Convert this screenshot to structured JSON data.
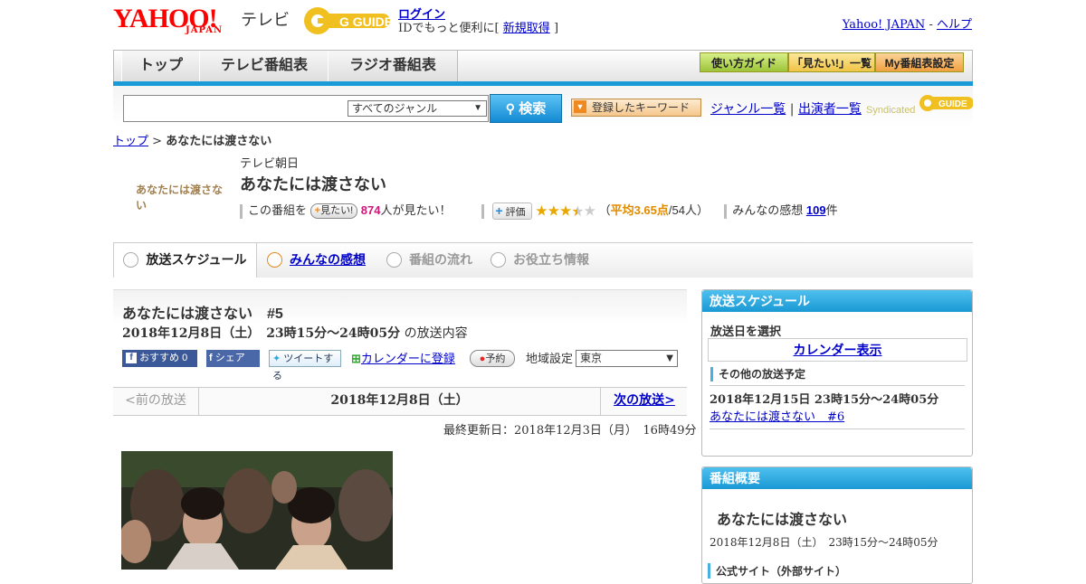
{
  "header": {
    "yahoo_logo": "YAHOO!",
    "japan_logo": "JAPAN",
    "tv_label": "テレビ",
    "gguide_logo": "G GUIDE",
    "login": "ログイン",
    "login_note_prefix": "IDでもっと便利に[",
    "register": "新規取得",
    "login_note_suffix": "]",
    "yahoo_japan_link": "Yahoo! JAPAN",
    "separator": " - ",
    "help_link": "ヘルプ"
  },
  "nav": {
    "tabs": [
      "トップ",
      "テレビ番組表",
      "ラジオ番組表"
    ],
    "guide_btn": "使い方ガイド",
    "wantsee_btn": "「見たい!」一覧",
    "myprog_btn": "My番組表設定"
  },
  "search": {
    "genre_selected": "すべてのジャンル",
    "search_btn": "検索",
    "keyword_btn": "登録したキーワード",
    "genre_list": "ジャンル一覧",
    "divider": " | ",
    "performer_list": "出演者一覧",
    "syndicated": "Syndicated"
  },
  "breadcrumb": {
    "top": "トップ",
    "sep": " > ",
    "current": "あなたには渡さない"
  },
  "program": {
    "thumb_text": "あなたには渡さない",
    "channel": "テレビ朝日",
    "title": "あなたには渡さない",
    "want_prefix": "この番組を",
    "want_btn": "見たい!",
    "want_count": "874",
    "want_suffix": "人が見たい！",
    "rate_btn": "評価",
    "rating_open": "（",
    "avg_label": "平均3.65点",
    "rating_people": "/54人）",
    "rating_value": 3.65,
    "impressions_label": "みんなの感想",
    "impressions_count": "109",
    "impressions_unit": "件"
  },
  "tabs": {
    "schedule": "放送スケジュール",
    "reviews": "みんなの感想",
    "flow": "番組の流れ",
    "info": "お役立ち情報"
  },
  "episode": {
    "title": "あなたには渡さない　#5",
    "datetime": "2018年12月8日（土）　23時15分～24時05分",
    "datetime_suffix": "の放送内容",
    "recommend_btn": "おすすめ",
    "recommend_count": "0",
    "share_btn": "シェア",
    "tweet_btn": "ツイートする",
    "calendar_link": "カレンダーに登録",
    "reserve_btn": "予約",
    "region_label": "地域設定",
    "region_value": "東京"
  },
  "pager": {
    "prev": "<前の放送",
    "current": "2018年12月8日（土）",
    "next": "次の放送>"
  },
  "updated": "最終更新日：2018年12月3日（月）　16時49分",
  "sidebar": {
    "schedule_head": "放送スケジュール",
    "select_date": "放送日を選択",
    "calendar_link": "カレンダー表示",
    "other_head": "その他の放送予定",
    "other_datetime": "2018年12月15日  23時15分～24時05分",
    "other_link": "あなたには渡さない　#6",
    "summary_head": "番組概要",
    "summary_title": "あなたには渡さない",
    "summary_datetime": "2018年12月8日（土）　23時15分～24時05分",
    "official_site": "公式サイト（外部サイト）"
  }
}
